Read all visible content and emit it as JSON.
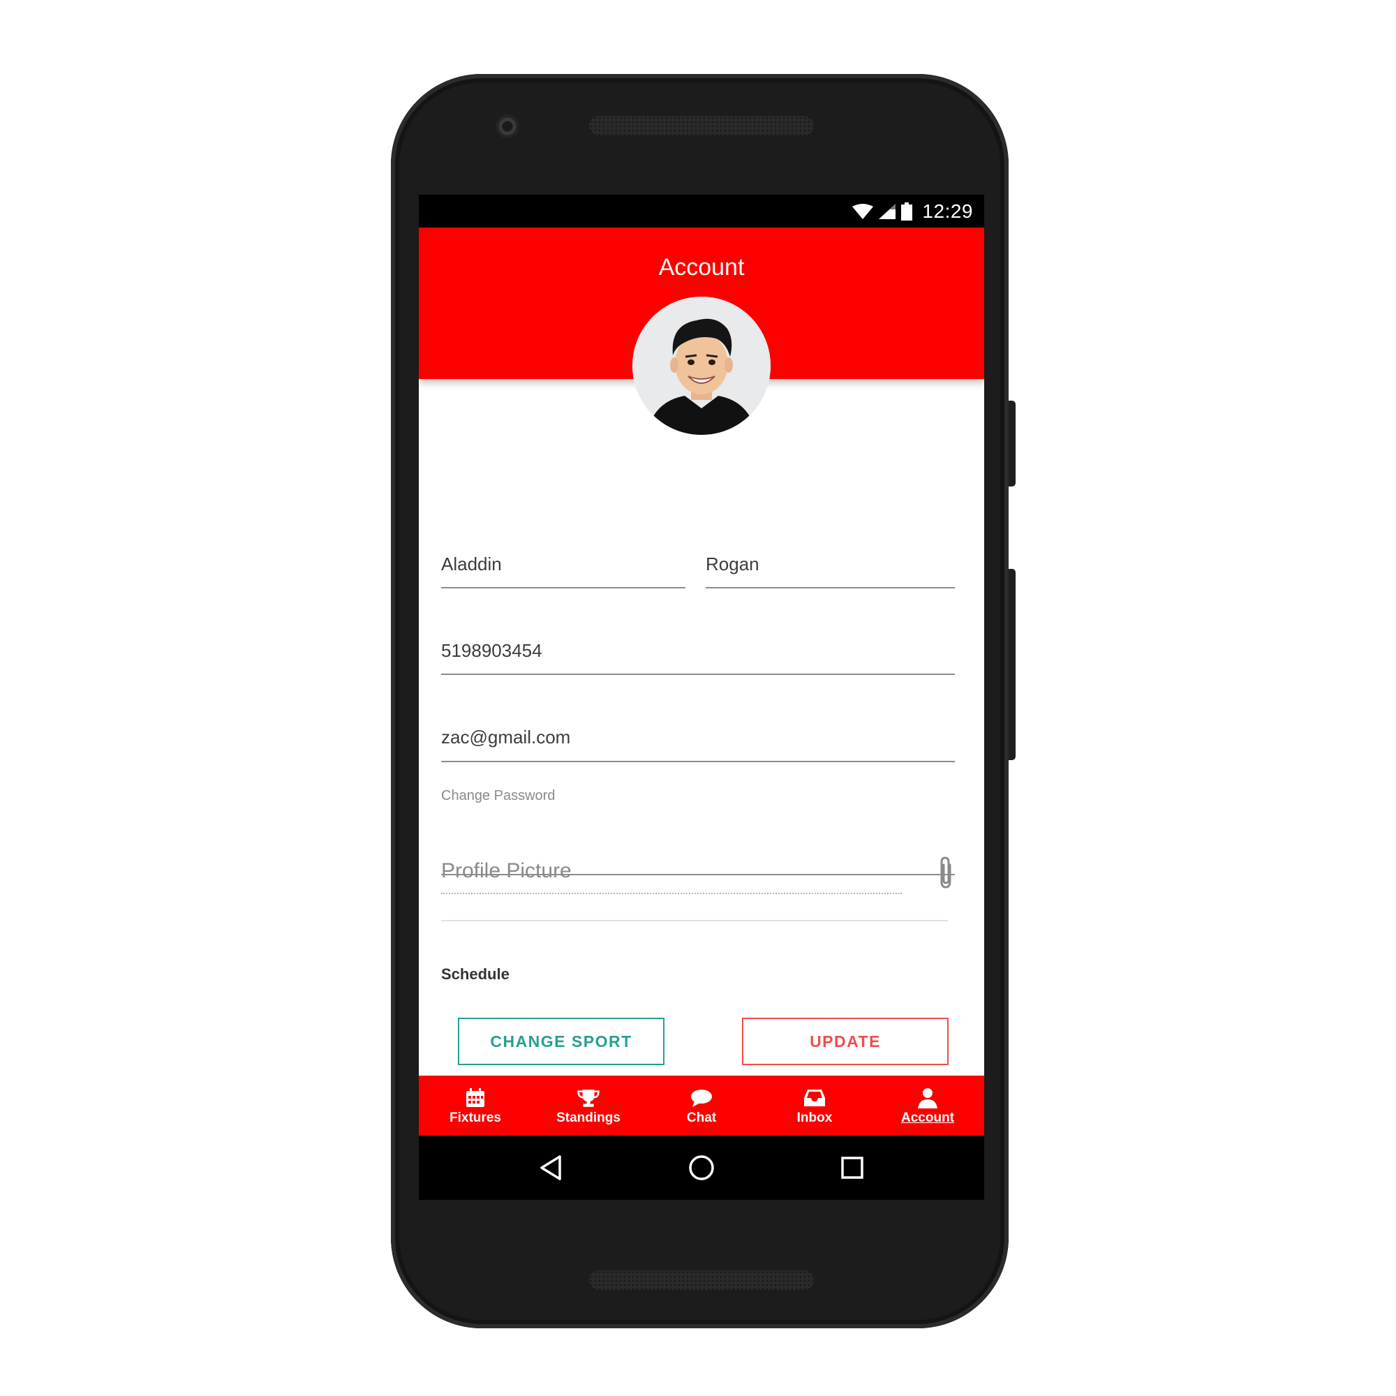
{
  "status_bar": {
    "time": "12:29",
    "icons": [
      "wifi-icon",
      "signal-icon",
      "battery-icon"
    ]
  },
  "header": {
    "title": "Account"
  },
  "form": {
    "first_name": "Aladdin",
    "last_name": "Rogan",
    "phone": "5198903454",
    "email": "zac@gmail.com",
    "change_password_label": "Change Password",
    "profile_picture_label": "Profile Picture",
    "schedule_label": "Schedule"
  },
  "buttons": {
    "change_sport": "CHANGE SPORT",
    "update": "UPDATE"
  },
  "bottom_nav": {
    "active": "Account",
    "items": [
      {
        "label": "Fixtures",
        "icon": "calendar-icon"
      },
      {
        "label": "Standings",
        "icon": "trophy-icon"
      },
      {
        "label": "Chat",
        "icon": "chat-bubble-icon"
      },
      {
        "label": "Inbox",
        "icon": "inbox-icon"
      },
      {
        "label": "Account",
        "icon": "person-icon"
      }
    ]
  },
  "system_nav": [
    "back-icon",
    "home-icon",
    "recents-icon"
  ],
  "colors": {
    "brand": "#fc0000",
    "secondary": "#26a08f",
    "update": "#ef4d4d"
  }
}
